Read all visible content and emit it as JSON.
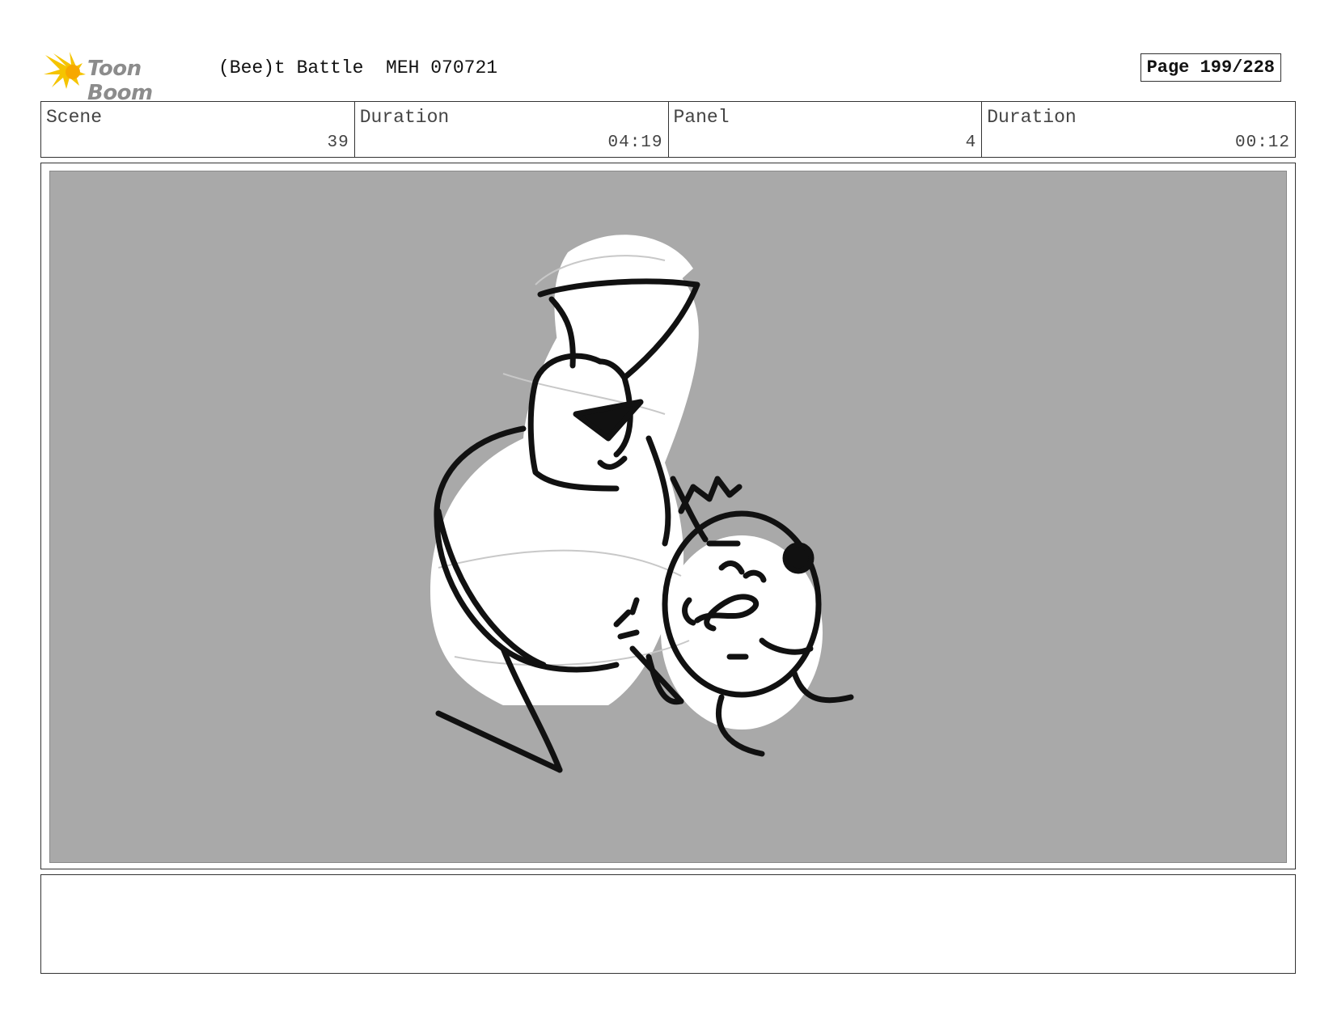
{
  "header": {
    "logo_text": "Toon Boom",
    "project_title": "(Bee)t Battle  MEH 070721",
    "page_label": "Page 199/228"
  },
  "info": [
    {
      "label": "Scene",
      "value": "39"
    },
    {
      "label": "Duration",
      "value": "04:19"
    },
    {
      "label": "Panel",
      "value": "4"
    },
    {
      "label": "Duration",
      "value": "00:12"
    }
  ],
  "colors": {
    "panel_background": "#a9a9a9",
    "logo_accent": "#f5c400"
  },
  "panel": {
    "icon": "sketch-illustration"
  },
  "notes": {
    "text": ""
  }
}
